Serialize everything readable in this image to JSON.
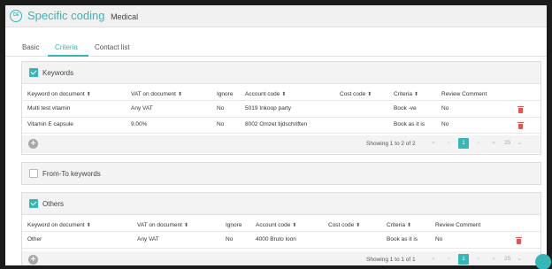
{
  "app": {
    "logo_text": "CE",
    "title": "Specific coding",
    "subtitle": "Medical"
  },
  "tabs": [
    {
      "label": "Basic"
    },
    {
      "label": "Criteria"
    },
    {
      "label": "Contact list"
    }
  ],
  "active_tab": "Criteria",
  "sort_icon": "⬍",
  "keywords": {
    "title": "Keywords",
    "checked": true,
    "columns": [
      "Keyword on document",
      "VAT on document",
      "Ignore",
      "Account code",
      "Cost code",
      "Criteria",
      "Review Comment"
    ],
    "rows": [
      [
        "Multi test vitamin",
        "Any VAT",
        "No",
        "5019 Inkoop party",
        "",
        "Book -ve",
        "No"
      ],
      [
        "Vitamin E capsule",
        "9.00%",
        "No",
        "8002 Omzet tijdschriften",
        "",
        "Book as it is",
        "No"
      ]
    ],
    "showing": "Showing 1 to 2 of 2",
    "page": "1",
    "page_size": "25"
  },
  "from_to": {
    "title": "From-To keywords",
    "checked": false
  },
  "others": {
    "title": "Others",
    "checked": true,
    "columns": [
      "Keyword on document",
      "VAT on document",
      "Ignore",
      "Account code",
      "Cost code",
      "Criteria",
      "Review Comment"
    ],
    "rows": [
      [
        "Other",
        "Any VAT",
        "No",
        "4000 Bruto loon",
        "",
        "Book as it is",
        "No"
      ]
    ],
    "showing": "Showing 1 to 1 of 1",
    "page": "1",
    "page_size": "25"
  },
  "pager_icons": {
    "first": "«",
    "prev": "‹",
    "next": "›",
    "last": "»",
    "dropdown": "⌄"
  },
  "accent_color": "#35b8b5",
  "delete_color": "#e05454"
}
